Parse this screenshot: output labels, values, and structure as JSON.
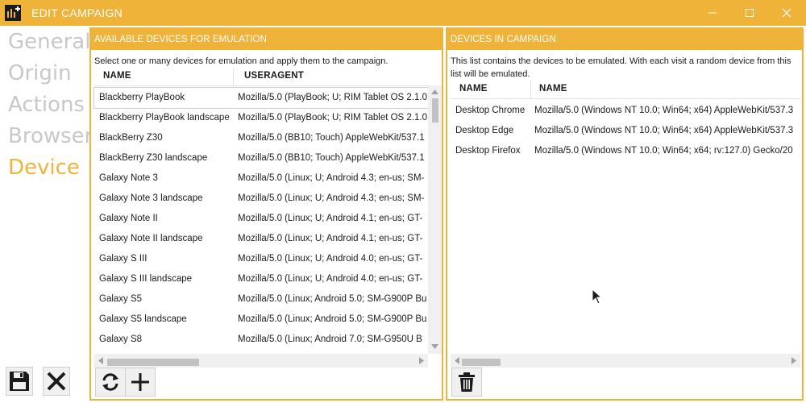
{
  "window": {
    "title": "EDIT CAMPAIGN"
  },
  "nav": {
    "items": [
      "General",
      "Origin",
      "Actions",
      "Browser",
      "Device"
    ],
    "active_index": 4
  },
  "available": {
    "header": "AVAILABLE DEVICES FOR EMULATION",
    "description": "Select one or many devices for emulation and apply them to the campaign.",
    "col_name": "NAME",
    "col_useragent": "USERAGENT",
    "rows": [
      {
        "name": "Blackberry PlayBook",
        "ua": "Mozilla/5.0 (PlayBook; U; RIM Tablet OS 2.1.0"
      },
      {
        "name": "Blackberry PlayBook landscape",
        "ua": "Mozilla/5.0 (PlayBook; U; RIM Tablet OS 2.1.0"
      },
      {
        "name": "BlackBerry Z30",
        "ua": "Mozilla/5.0 (BB10; Touch) AppleWebKit/537.1"
      },
      {
        "name": "BlackBerry Z30 landscape",
        "ua": "Mozilla/5.0 (BB10; Touch) AppleWebKit/537.1"
      },
      {
        "name": "Galaxy Note 3",
        "ua": "Mozilla/5.0 (Linux; U; Android 4.3; en-us; SM-"
      },
      {
        "name": "Galaxy Note 3 landscape",
        "ua": "Mozilla/5.0 (Linux; U; Android 4.3; en-us; SM-"
      },
      {
        "name": "Galaxy Note II",
        "ua": "Mozilla/5.0 (Linux; U; Android 4.1; en-us; GT-"
      },
      {
        "name": "Galaxy Note II landscape",
        "ua": "Mozilla/5.0 (Linux; U; Android 4.1; en-us; GT-"
      },
      {
        "name": "Galaxy S III",
        "ua": "Mozilla/5.0 (Linux; U; Android 4.0; en-us; GT-"
      },
      {
        "name": "Galaxy S III landscape",
        "ua": "Mozilla/5.0 (Linux; U; Android 4.0; en-us; GT-"
      },
      {
        "name": "Galaxy S5",
        "ua": "Mozilla/5.0 (Linux; Android 5.0; SM-G900P Bu"
      },
      {
        "name": "Galaxy S5 landscape",
        "ua": "Mozilla/5.0 (Linux; Android 5.0; SM-G900P Bu"
      },
      {
        "name": "Galaxy S8",
        "ua": "Mozilla/5.0 (Linux; Android 7.0; SM-G950U B"
      }
    ],
    "selected_index": 0
  },
  "campaign": {
    "header": "DEVICES IN CAMPAIGN",
    "description": "This list contains the devices to be emulated. With each visit a random device from this list will be emulated.",
    "col_name": "NAME",
    "col_name2": "NAME",
    "rows": [
      {
        "name": "Desktop Chrome",
        "ua": "Mozilla/5.0 (Windows NT 10.0; Win64; x64) AppleWebKit/537.3"
      },
      {
        "name": "Desktop Edge",
        "ua": "Mozilla/5.0 (Windows NT 10.0; Win64; x64) AppleWebKit/537.3"
      },
      {
        "name": "Desktop Firefox",
        "ua": "Mozilla/5.0 (Windows NT 10.0; Win64; x64; rv:127.0) Gecko/20"
      }
    ]
  },
  "icons": {
    "save": "floppy-disk-icon",
    "cancel": "close-x-icon",
    "refresh": "refresh-icon",
    "add": "plus-icon",
    "delete": "trash-icon"
  },
  "colors": {
    "accent": "#f0b33a",
    "nav_inactive": "#c8c8c8",
    "text": "#1a1a1a"
  }
}
